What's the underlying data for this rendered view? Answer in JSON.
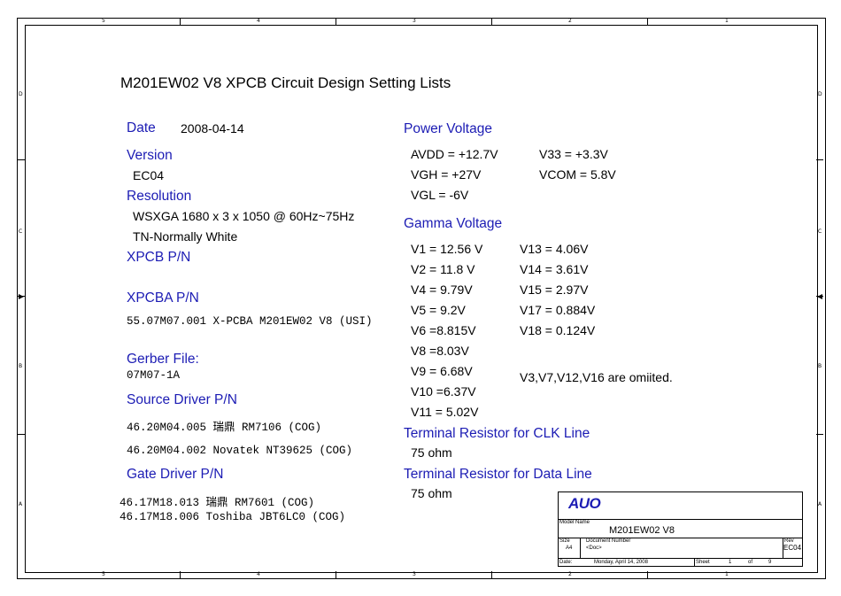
{
  "border_zones": {
    "columns": [
      "5",
      "4",
      "3",
      "2",
      "1"
    ],
    "rows": [
      "D",
      "C",
      "B",
      "A"
    ]
  },
  "doc_title": "M201EW02 V8 XPCB Circuit Design Setting Lists",
  "left": {
    "date_label": "Date",
    "date_value": "2008-04-14",
    "version_label": "Version",
    "version_value": "EC04",
    "resolution_label": "Resolution",
    "resolution_value_1": "WSXGA 1680 x 3 x 1050 @ 60Hz~75Hz",
    "resolution_value_2": "TN-Normally White",
    "xpcb_label": "XPCB P/N",
    "xpcba_label": "XPCBA P/N",
    "xpcba_value": "55.07M07.001 X-PCBA M201EW02 V8 (USI)",
    "gerber_label": "Gerber File:",
    "gerber_value": "07M07-1A",
    "source_label": "Source Driver P/N",
    "source_values": [
      "46.20M04.005  瑞鼎   RM7106 (COG)",
      "46.20M04.002 Novatek  NT39625  (COG)"
    ],
    "gate_label": "Gate Driver P/N",
    "gate_values": [
      "46.17M18.013 瑞鼎 RM7601  (COG)",
      "46.17M18.006   Toshiba JBT6LC0  (COG)"
    ]
  },
  "right": {
    "power_label": "Power Voltage",
    "power_rows": [
      [
        "AVDD = +12.7V",
        "V33 = +3.3V"
      ],
      [
        "VGH = +27V",
        "VCOM = 5.8V"
      ],
      [
        "VGL = -6V",
        ""
      ]
    ],
    "gamma_label": "Gamma Voltage",
    "gamma_col1": [
      "V1 = 12.56 V",
      "V2 = 11.8 V",
      "V4 = 9.79V",
      "V5 = 9.2V",
      "V6 =8.815V",
      "V8 =8.03V",
      "V9 = 6.68V",
      "V10 =6.37V",
      "V11 = 5.02V"
    ],
    "gamma_col2": [
      "V13 = 4.06V",
      "V14 = 3.61V",
      "V15 = 2.97V",
      "V17 = 0.884V",
      "V18 = 0.124V"
    ],
    "gamma_note": "V3,V7,V12,V16 are omiited.",
    "clk_label": "Terminal Resistor for CLK Line",
    "clk_value": "75 ohm",
    "data_label": "Terminal Resistor for Data Line",
    "data_value": "75 ohm"
  },
  "title_block": {
    "logo": "AUO",
    "model_name_label": "Model Name",
    "model_name_value": "M201EW02 V8",
    "size_label": "Size",
    "size_value": "A4",
    "docnum_label": "Document Number",
    "docnum_value": "<Doc>",
    "rev_label": "Rev",
    "rev_value": "EC04",
    "date_label": "Date:",
    "date_value": "Monday, April 14, 2008",
    "sheet_label": "Sheet",
    "sheet_num": "1",
    "of_label": "of",
    "sheet_total": "9"
  }
}
